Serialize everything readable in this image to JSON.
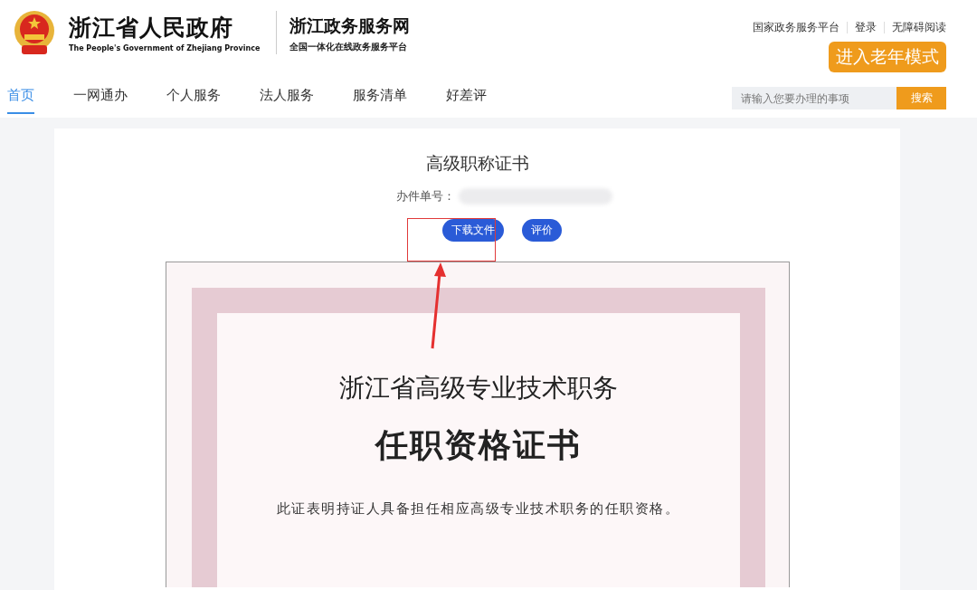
{
  "header": {
    "title": "浙江省人民政府",
    "subtitle": "The People's Government of Zhejiang Province",
    "portal_title": "浙江政务服务网",
    "portal_subtitle": "全国一体化在线政务服务平台",
    "top_links": [
      "国家政务服务平台",
      "登录",
      "无障碍阅读"
    ],
    "elder_mode_button": "进入老年模式"
  },
  "nav": {
    "tabs": [
      {
        "label": "首页",
        "selected": true
      },
      {
        "label": "一网通办",
        "selected": false
      },
      {
        "label": "个人服务",
        "selected": false
      },
      {
        "label": "法人服务",
        "selected": false
      },
      {
        "label": "服务清单",
        "selected": false
      },
      {
        "label": "好差评",
        "selected": false
      }
    ],
    "search": {
      "placeholder": "请输入您要办理的事项",
      "button": "搜索"
    }
  },
  "document": {
    "title": "高级职称证书",
    "number_label": "办件单号：",
    "buttons": [
      "下载文件",
      "评价"
    ],
    "certificate": {
      "heading": "浙江省高级专业技术职务",
      "title": "任职资格证书",
      "statement": "此证表明持证人具备担任相应高级专业技术职务的任职资格。"
    }
  }
}
